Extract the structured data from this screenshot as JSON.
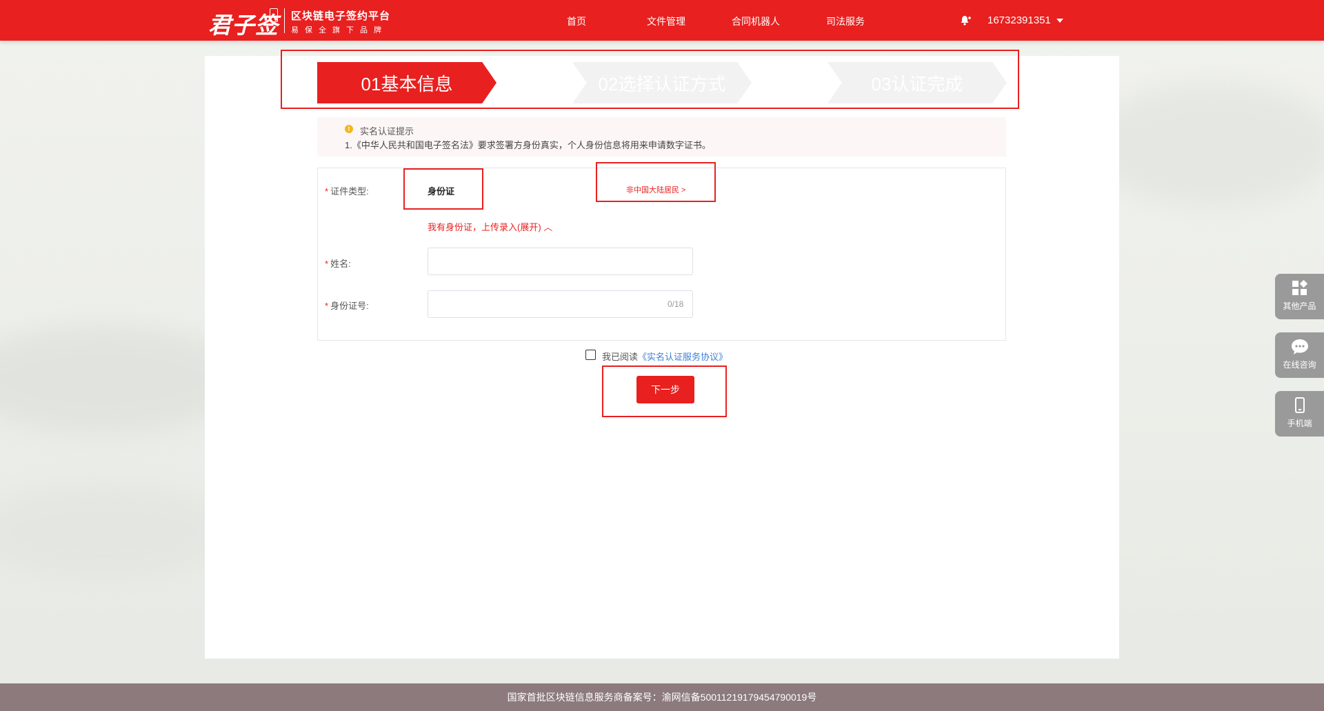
{
  "header": {
    "logo": "君子签",
    "tagline": "区块链电子签约平台",
    "subtitle": "易保全旗下品牌",
    "nav": [
      {
        "label": "首页"
      },
      {
        "label": "文件管理"
      },
      {
        "label": "合同机器人"
      },
      {
        "label": "司法服务"
      }
    ],
    "phone": "16732391351"
  },
  "steps": [
    {
      "label": "01基本信息"
    },
    {
      "label": "02选择认证方式"
    },
    {
      "label": "03认证完成"
    }
  ],
  "notice": {
    "title": "实名认证提示",
    "text": "1.《中华人民共和国电子签名法》要求签署方身份真实，个人身份信息将用来申请数字证书。"
  },
  "form": {
    "id_type_label": "证件类型:",
    "id_type_value": "身份证",
    "foreign_link": "非中国大陆居民 >",
    "upload_link": "我有身份证，上传录入(展开) ︿",
    "name_label": "姓名:",
    "name_value": "",
    "id_number_label": "身份证号:",
    "id_number_value": "",
    "id_counter": "0/18"
  },
  "agreement": {
    "prefix": "我已阅读",
    "link": "《实名认证服务协议》",
    "checked": false
  },
  "next_button": "下一步",
  "side_buttons": [
    {
      "label": "其他产品",
      "icon": "apps-icon"
    },
    {
      "label": "在线咨询",
      "icon": "chat-icon"
    },
    {
      "label": "手机端",
      "icon": "mobile-icon"
    }
  ],
  "footer": "国家首批区块链信息服务商备案号：渝网信备50011219179454790019号",
  "colors": {
    "brand": "#e8201f",
    "footer": "#8c7a7c",
    "link": "#3d7fd6"
  }
}
